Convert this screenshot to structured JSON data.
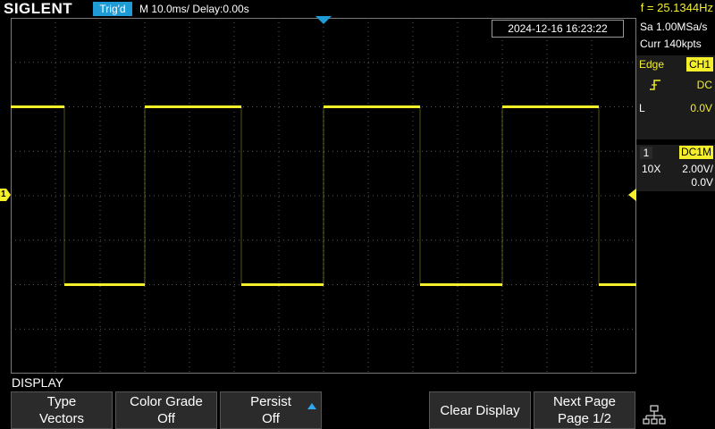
{
  "header": {
    "brand": "SIGLENT",
    "trigger_status": "Trig'd",
    "timebase": "M 10.0ms/ Delay:0.00s",
    "frequency": "f = 25.1344Hz"
  },
  "timestamp": "2024-12-16 16:23:22",
  "acquisition": {
    "sample_rate": "Sa 1.00MSa/s",
    "memory": "Curr 140kpts"
  },
  "trigger": {
    "type_label": "Edge",
    "source": "CH1",
    "coupling": "DC",
    "level_label": "L",
    "level": "0.0V"
  },
  "channel1": {
    "number": "1",
    "coupling": "DC1M",
    "probe": "10X",
    "volts_div": "2.00V/",
    "offset": "0.0V",
    "marker": "1"
  },
  "waveform": {
    "color": "#f4ef2a",
    "high_div": 2.0,
    "low_div": -2.0,
    "edges_div": [
      0.6,
      1.5,
      2.58,
      3.5,
      4.58,
      5.5,
      6.58
    ],
    "starts_high": true
  },
  "menu": {
    "title": "DISPLAY",
    "keys": [
      {
        "line1": "Type",
        "line2": "Vectors"
      },
      {
        "line1": "Color Grade",
        "line2": "Off"
      },
      {
        "line1": "Persist",
        "line2": "Off"
      },
      {
        "line1": "Clear Display"
      },
      {
        "line1": "Next Page",
        "line2": "Page 1/2"
      }
    ]
  },
  "colors": {
    "accent_blue": "#1f9bd6",
    "trace_yellow": "#f4ef2a",
    "grid": "#5a5a5a"
  },
  "icons": {
    "trigger_slope": "rising-edge-icon",
    "network": "network-icon",
    "persist_arrow": "arrow-up-icon"
  }
}
